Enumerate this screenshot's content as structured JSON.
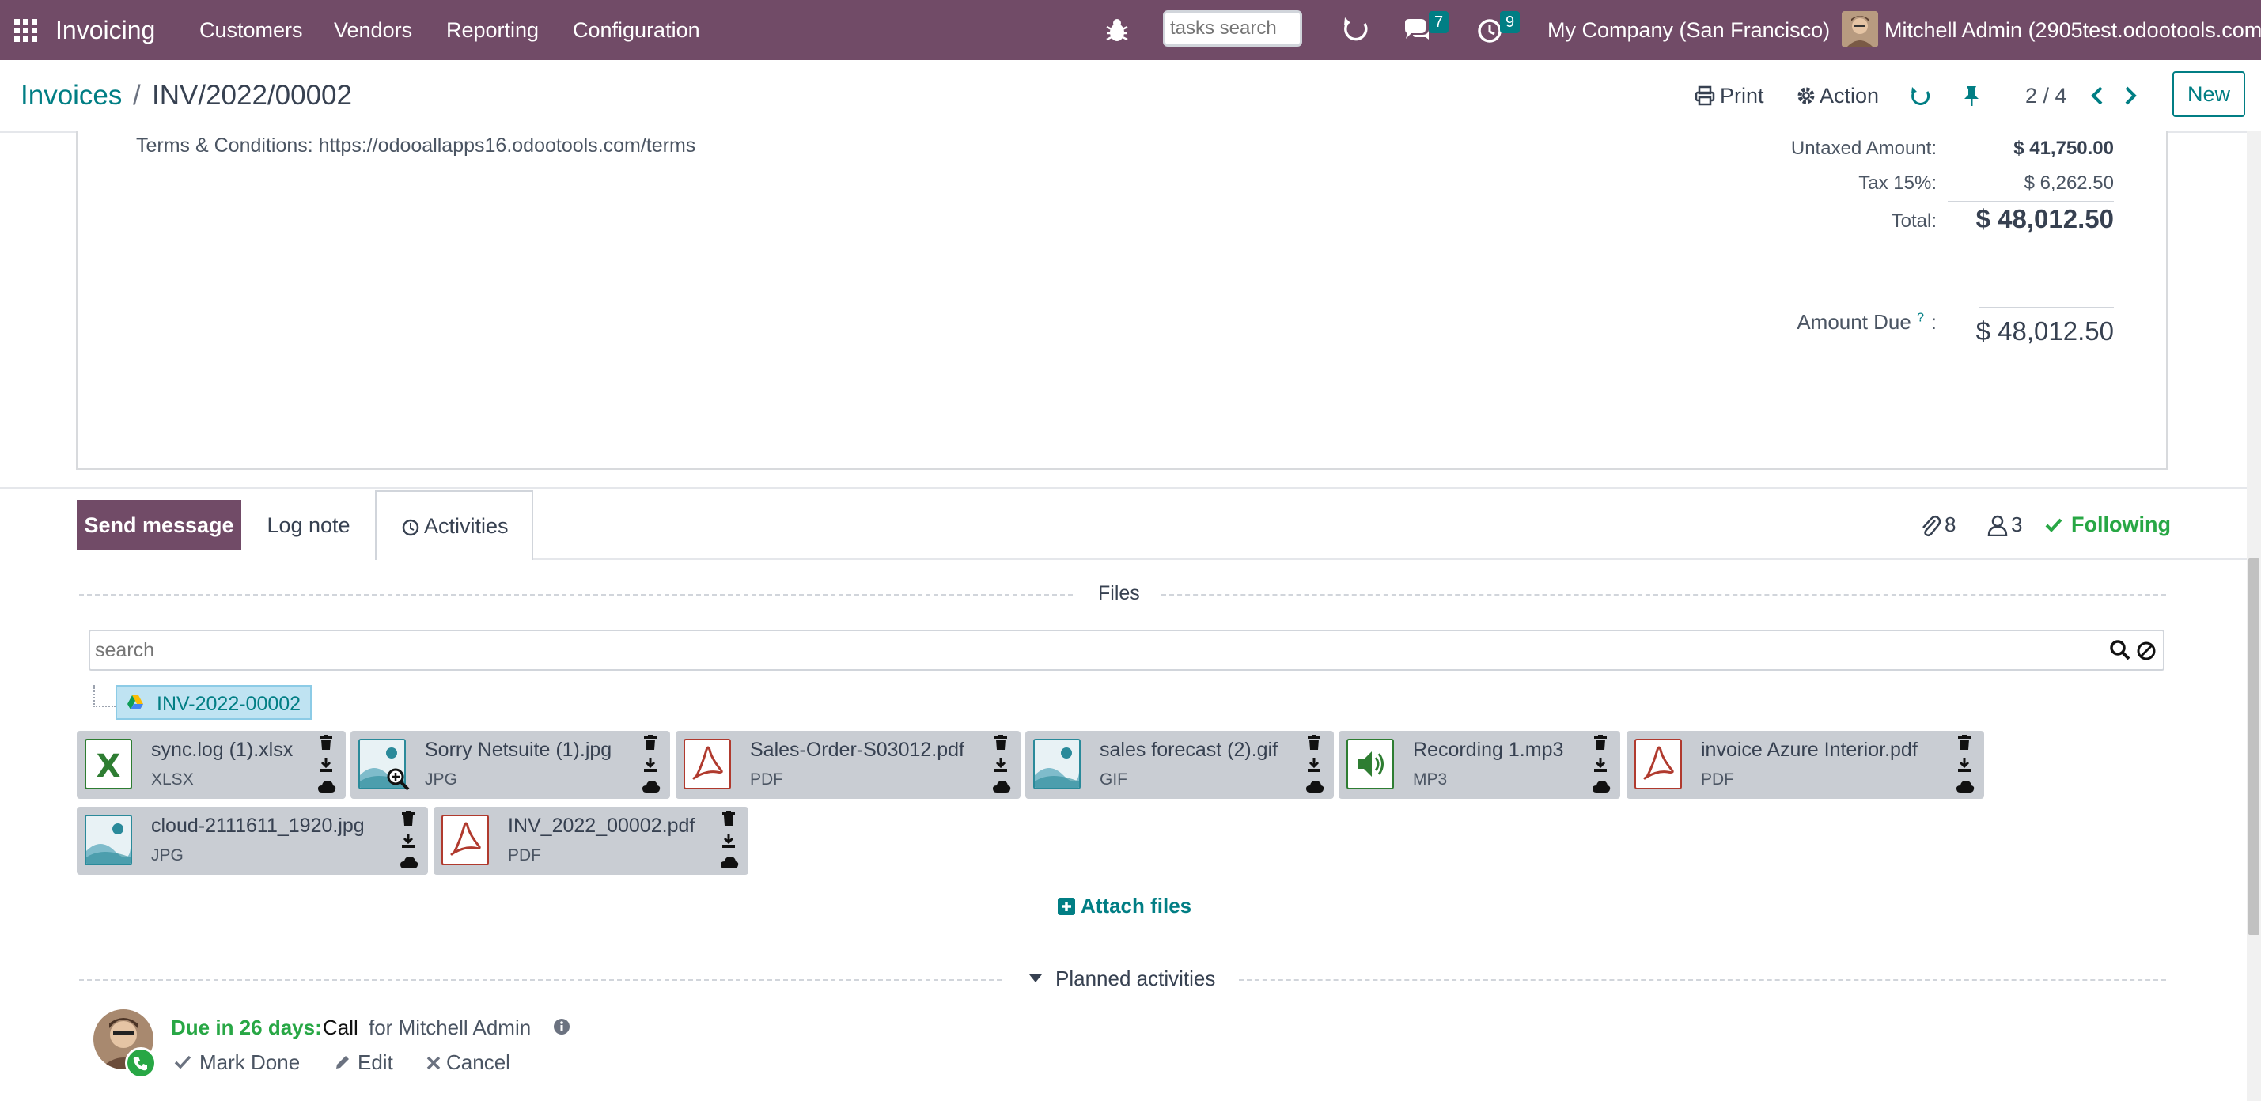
{
  "nav": {
    "app_name": "Invoicing",
    "menu": [
      "Customers",
      "Vendors",
      "Reporting",
      "Configuration"
    ],
    "search_placeholder": "tasks search",
    "messages_count": "7",
    "activities_count": "9",
    "company": "My Company (San Francisco)",
    "user": "Mitchell Admin (2905test.odootools.com)"
  },
  "breadcrumb": {
    "parent": "Invoices",
    "separator": "/",
    "current": "INV/2022/00002"
  },
  "toolbar": {
    "print_label": "Print",
    "action_label": "Action",
    "pager": "2 / 4",
    "new_label": "New"
  },
  "sheet": {
    "terms": "Terms & Conditions: https://odooallapps16.odootools.com/terms",
    "untaxed_label": "Untaxed Amount:",
    "untaxed_value": "$ 41,750.00",
    "tax_label": "Tax 15%:",
    "tax_value": "$ 6,262.50",
    "total_label": "Total:",
    "total_value": "$ 48,012.50",
    "amount_due_label": "Amount Due",
    "amount_due_help": "?",
    "amount_due_colon": ":",
    "amount_due_value": "$ 48,012.50"
  },
  "chatter": {
    "send_message": "Send message",
    "log_note": "Log note",
    "activities": "Activities",
    "attachments_count": "8",
    "followers_count": "3",
    "following_label": "Following",
    "files_title": "Files",
    "search_placeholder": "search",
    "folder_name": "INV-2022-00002",
    "attach_files": "Attach files",
    "planned_activities": "Planned activities"
  },
  "attachments": [
    {
      "name": "sync.log (1).xlsx",
      "ext": "XLSX",
      "kind": "excel"
    },
    {
      "name": "Sorry Netsuite (1).jpg",
      "ext": "JPG",
      "kind": "image"
    },
    {
      "name": "Sales-Order-S03012.pdf",
      "ext": "PDF",
      "kind": "pdf"
    },
    {
      "name": "sales forecast (2).gif",
      "ext": "GIF",
      "kind": "image"
    },
    {
      "name": "Recording 1.mp3",
      "ext": "MP3",
      "kind": "audio"
    },
    {
      "name": "invoice Azure Interior.pdf",
      "ext": "PDF",
      "kind": "pdf"
    },
    {
      "name": "cloud-2111611_1920.jpg",
      "ext": "JPG",
      "kind": "image"
    },
    {
      "name": "INV_2022_00002.pdf",
      "ext": "PDF",
      "kind": "pdf"
    }
  ],
  "activity": {
    "due": "Due in 26 days:",
    "type": "Call",
    "for_user": "for Mitchell Admin",
    "mark_done": "Mark Done",
    "edit": "Edit",
    "cancel": "Cancel"
  },
  "colors": {
    "brand": "#714b67",
    "teal": "#017e84",
    "success": "#28a745",
    "pdf_red": "#b03a2e",
    "excel_green": "#2e7d32"
  }
}
